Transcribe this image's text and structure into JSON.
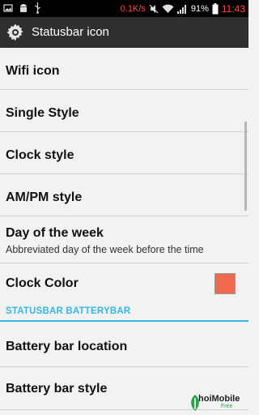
{
  "status_bar": {
    "net_speed": "0.1K/s",
    "battery_percent": "91%",
    "time": "11:43"
  },
  "action_bar": {
    "title": "Statusbar icon"
  },
  "items": [
    {
      "title": "Wifi icon"
    },
    {
      "title": "Single Style"
    },
    {
      "title": "Clock style"
    },
    {
      "title": "AM/PM style"
    },
    {
      "title": "Day of the week",
      "summary": "Abbreviated day of the week before the time"
    },
    {
      "title": "Clock Color",
      "color": "#ef6a4e"
    }
  ],
  "category": {
    "label": "STATUSBAR BATTERYBAR"
  },
  "items2": [
    {
      "title": "Battery bar location"
    },
    {
      "title": "Battery bar style"
    }
  ],
  "watermark": {
    "brand": "hoiMobile",
    "sub": "Free"
  },
  "colors": {
    "accent": "#33b5e5",
    "alert": "#ff4a3a"
  }
}
